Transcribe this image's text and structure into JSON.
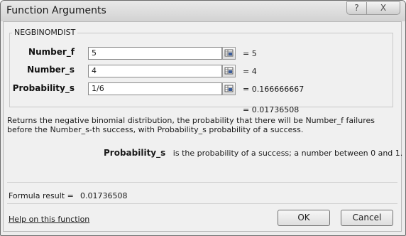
{
  "window": {
    "title": "Function Arguments",
    "help_glyph": "?",
    "close_glyph": "X"
  },
  "function_name": "NEGBINOMDIST",
  "arguments": [
    {
      "label": "Number_f",
      "value": "5",
      "result": "= 5"
    },
    {
      "label": "Number_s",
      "value": "4",
      "result": "= 4"
    },
    {
      "label": "Probability_s",
      "value": "1/6",
      "result": "= 0.166666667"
    }
  ],
  "function_result": "= 0.01736508",
  "description": "Returns the negative binomial distribution, the probability that there will be Number_f failures before the Number_s-th success, with Probability_s probability of a success.",
  "param_help": {
    "name": "Probability_s",
    "text": "is the probability of a success; a number between 0 and 1."
  },
  "formula_result": {
    "label": "Formula result =",
    "value": "0.01736508"
  },
  "footer": {
    "help_link": "Help on this function",
    "ok_label": "OK",
    "cancel_label": "Cancel"
  },
  "icons": {
    "ref": "range-selector-icon",
    "help": "help-icon",
    "close": "close-icon"
  }
}
